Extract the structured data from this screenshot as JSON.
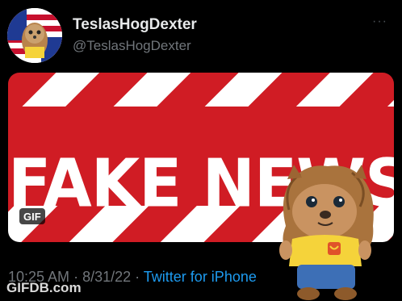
{
  "tweet": {
    "display_name": "TeslasHogDexter",
    "handle": "@TeslasHogDexter",
    "more_label": "···",
    "media": {
      "banner_text": "FAKE NEWS",
      "badge": "GIF"
    },
    "time": "10:25 AM",
    "separator1": " · ",
    "date": "8/31/22",
    "separator2": " · ",
    "source": "Twitter for iPhone"
  },
  "watermark": "GIFDB.com",
  "icons": {
    "avatar": "hedgehog-mascot-flag-avatar",
    "more": "more-options-icon",
    "sticker": "hedgehog-mascot"
  },
  "colors": {
    "banner_red": "#d01c24",
    "banner_white": "#ffffff",
    "source_link": "#1d9bf0",
    "muted_text": "#71767b",
    "shirt_yellow": "#f5d33a"
  }
}
